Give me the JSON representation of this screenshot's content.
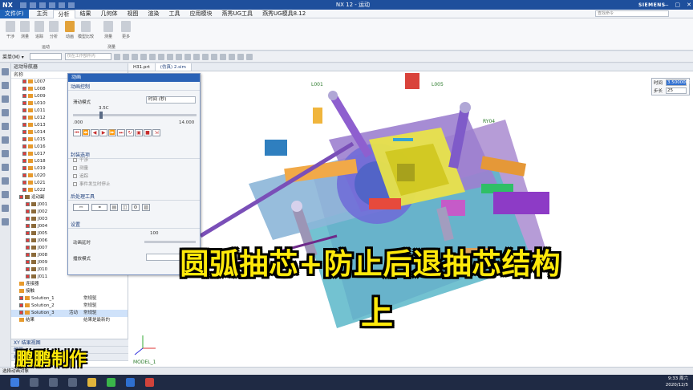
{
  "titlebar": {
    "logo": "NX",
    "title": "NX 12 - 运动",
    "brand": "SIEMENS",
    "min": "—",
    "max": "▢",
    "close": "✕"
  },
  "menubar": {
    "file": "文件(F)",
    "items": [
      "主页",
      "分析",
      "结果",
      "几何体",
      "视图",
      "渲染",
      "工具",
      "应用模块",
      "燕秀UG工具",
      "燕秀UG模具8.12"
    ],
    "active_index": 1,
    "search_placeholder": "查找命令"
  },
  "ribbon": {
    "buttons": [
      "干涉",
      "测量",
      "追踪",
      "分析",
      "动画",
      "模型比较",
      "测量",
      "更多"
    ],
    "groups": [
      "运动",
      "测量"
    ]
  },
  "toolrow": {
    "menu": "菜单(M) ▾",
    "filter_placeholder": "仅在工作部件内"
  },
  "navigator": {
    "header": "运动导航器",
    "col_name": "名称",
    "links": [
      "L007",
      "L008",
      "L009",
      "L010",
      "L011",
      "L012",
      "L013",
      "L014",
      "L015",
      "L016",
      "L017",
      "L018",
      "L019",
      "L020",
      "L021",
      "L022"
    ],
    "joints_group": "运动副",
    "joints": [
      "J001",
      "J002",
      "J003",
      "J004",
      "J005",
      "J006",
      "J007",
      "J008",
      "J009",
      "J010",
      "J011"
    ],
    "extra": [
      {
        "name": "连接器",
        "col": ""
      },
      {
        "name": "接触",
        "col": ""
      },
      {
        "name": "Solution_1",
        "col": "常规驱"
      },
      {
        "name": "Solution_2",
        "col": "常规驱"
      },
      {
        "name": "Solution_3",
        "col": "常规驱",
        "status": "活动"
      },
      {
        "name": "结果",
        "col": "结果是最新的"
      }
    ],
    "xy_section": "XY 结果视图",
    "bottom_sections": [
      "细节",
      "相依性"
    ]
  },
  "dialog": {
    "title": "动画",
    "section_control": "动画控制",
    "slider_mode_label": "滑动模式",
    "slider_mode_value": "时间 (秒)",
    "current_value": "3.5C",
    "range_min": ".000",
    "range_max": "14.000",
    "section_options": "封装选项",
    "options": [
      "干涉",
      "测量",
      "追踪",
      "事件发生时停止"
    ],
    "section_post": "后处理工具",
    "section_settings": "设置",
    "delay_label": "动画延时",
    "delay_value": "100",
    "playback_label": "播放模式"
  },
  "viewport": {
    "tabs": [
      "H31.prt",
      "(仿真) 2.sim"
    ],
    "time_label": "时间",
    "time_value": "3.5000000",
    "step_label": "步长",
    "step_value": "25",
    "labels": [
      "L001",
      "L005",
      "RY04",
      "MODEL_1"
    ]
  },
  "overlay": {
    "headline": "圆弧抽芯+防止后退抽芯结构",
    "headline2": "上",
    "author": "鹏鹏制作"
  },
  "status": "选择动画对象",
  "clock": {
    "time": "9:33 周六",
    "date": "2020/12/5"
  }
}
